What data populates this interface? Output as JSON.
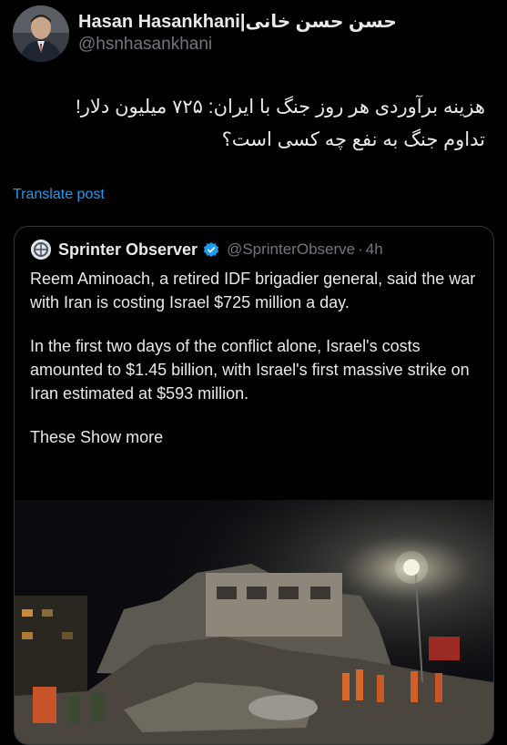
{
  "author": {
    "name": "Hasan Hasankhani|حسن حسن خانی",
    "handle": "@hsnhasankhani"
  },
  "post": {
    "lines": [
      "هزینه برآوردی هر روز جنگ با ایران: ۷۲۵ میلیون دلار!",
      "تداوم جنگ به نفع چه کسی است؟"
    ],
    "translate_label": "Translate post"
  },
  "quoted": {
    "name": "Sprinter Observer",
    "handle": "@SprinterObserve",
    "separator": "·",
    "time": "4h",
    "paragraph1": "Reem Aminoach, a retired IDF brigadier general, said the war with Iran is costing Israel $725 million a day.",
    "paragraph2": "In the first two days of the conflict alone, Israel's costs amounted to $1.45 billion, with Israel's first massive strike on Iran estimated at $593 million.",
    "teaser": "These",
    "show_more": "Show more"
  },
  "colors": {
    "background": "#000000",
    "text": "#e7e9ea",
    "muted": "#71767b",
    "link": "#1d9bf0",
    "verified": "#1d9bf0",
    "border": "#333639"
  },
  "icons": {
    "verified": "verified-badge-icon"
  }
}
